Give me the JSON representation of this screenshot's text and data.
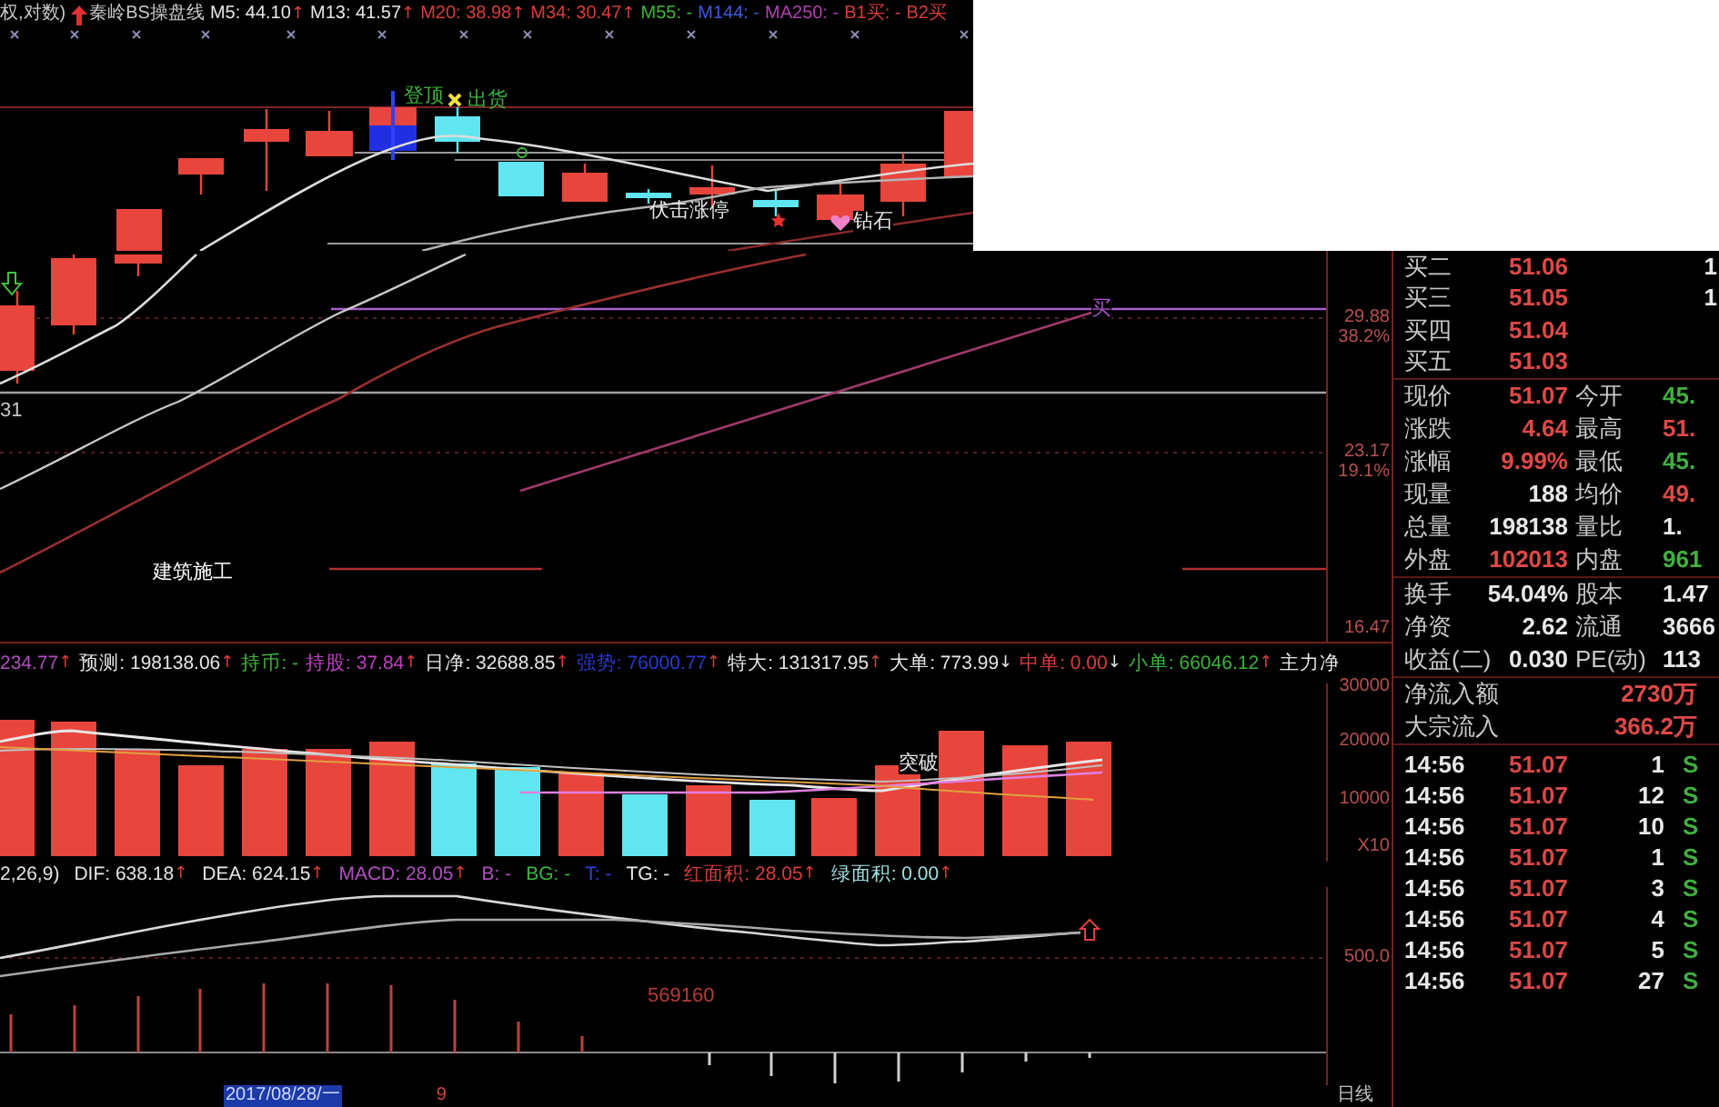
{
  "price_chart": {
    "legend": [
      {
        "kind": "text",
        "text": "权,对数)",
        "color": "#c8c8c8"
      },
      {
        "kind": "title",
        "text": "秦岭BS操盘线",
        "color": "#c8c8c8"
      },
      {
        "kind": "text",
        "text": "M5: 44.10",
        "color": "#e6e6e6",
        "arrow": {
          "text": "↑",
          "color": "#e03c3c"
        }
      },
      {
        "kind": "text",
        "text": "M13: 41.57",
        "color": "#e6e6e6",
        "arrow": {
          "text": "↑",
          "color": "#e03c3c"
        }
      },
      {
        "kind": "text",
        "text": "M20: 38.98",
        "color": "#d83c3c",
        "arrow": {
          "text": "↑",
          "color": "#e03c3c"
        }
      },
      {
        "kind": "text",
        "text": "M34: 30.47",
        "color": "#d83c3c",
        "arrow": {
          "text": "↑",
          "color": "#e03c3c"
        }
      },
      {
        "kind": "text",
        "text": "M55: -",
        "color": "#3cb43c"
      },
      {
        "kind": "text",
        "text": "M144: -",
        "color": "#3c5ad8"
      },
      {
        "kind": "text",
        "text": "MA250: -",
        "color": "#b040b0"
      },
      {
        "kind": "text",
        "text": "B1买: -",
        "color": "#d83c3c"
      },
      {
        "kind": "text",
        "text": "B2买",
        "color": "#d83c3c"
      }
    ],
    "annotations": [
      {
        "text": "登顶",
        "color": "#3cb43c"
      },
      {
        "text": "出货",
        "color": "#3cb43c"
      },
      {
        "text": "伏击涨停",
        "color": "#e6e6e6"
      },
      {
        "text": "钻石",
        "color": "#e6e6e6"
      },
      {
        "text": "31",
        "color": "#c8c8c8"
      },
      {
        "text": "建筑施工",
        "color": "#ffffff"
      },
      {
        "text": "买",
        "color": "#b050d0"
      }
    ],
    "axis_labels": [
      "29.88",
      "38.2%",
      "23.17",
      "19.1%",
      "16.47"
    ]
  },
  "volume_chart": {
    "legend": [
      {
        "kind": "text",
        "text": "234.77",
        "color": "#b050c0",
        "arrow": {
          "text": "↑",
          "color": "#e03c3c"
        }
      },
      {
        "kind": "text",
        "text": "预测: 198138.06",
        "color": "#e6e6e6",
        "arrow": {
          "text": "↑",
          "color": "#e03c3c"
        }
      },
      {
        "kind": "text",
        "text": "持币: -",
        "color": "#3cb43c"
      },
      {
        "kind": "text",
        "text": "持股: 37.84",
        "color": "#c040c0",
        "arrow": {
          "text": "↑",
          "color": "#e03c3c"
        }
      },
      {
        "kind": "text",
        "text": "日净: 32688.85",
        "color": "#e6e6e6",
        "arrow": {
          "text": "↑",
          "color": "#e03c3c"
        }
      },
      {
        "kind": "text",
        "text": "强势: 76000.77",
        "color": "#2a3ad0",
        "arrow": {
          "text": "↑",
          "color": "#e03c3c"
        }
      },
      {
        "kind": "text",
        "text": "特大: 131317.95",
        "color": "#e6e6e6",
        "arrow": {
          "text": "↑",
          "color": "#e03c3c"
        }
      },
      {
        "kind": "text",
        "text": "大单: 773.99",
        "color": "#e6e6e6",
        "arrow": {
          "text": "↓",
          "color": "#e6e6e6"
        }
      },
      {
        "kind": "text",
        "text": "中单: 0.00",
        "color": "#d83c3c",
        "arrow": {
          "text": "↓",
          "color": "#e6e6e6"
        }
      },
      {
        "kind": "text",
        "text": "小单: 66046.12",
        "color": "#3cb43c",
        "arrow": {
          "text": "↑",
          "color": "#e03c3c"
        }
      },
      {
        "kind": "text",
        "text": "主力净",
        "color": "#e6e6e6"
      }
    ],
    "annotation": "突破",
    "axis_labels": [
      "30000",
      "20000",
      "10000",
      "X10"
    ]
  },
  "macd_chart": {
    "legend": [
      {
        "kind": "text",
        "text": "2,26,9)",
        "color": "#e6e6e6"
      },
      {
        "kind": "text",
        "text": "DIF: 638.18",
        "color": "#e6e6e6",
        "arrow": {
          "text": "↑",
          "color": "#e03c3c"
        }
      },
      {
        "kind": "text",
        "text": "DEA: 624.15",
        "color": "#e6e6e6",
        "arrow": {
          "text": "↑",
          "color": "#e03c3c"
        }
      },
      {
        "kind": "text",
        "text": "MACD: 28.05",
        "color": "#b050c0",
        "arrow": {
          "text": "↑",
          "color": "#e03c3c"
        }
      },
      {
        "kind": "text",
        "text": "B: -",
        "color": "#b050c0"
      },
      {
        "kind": "text",
        "text": "BG: -",
        "color": "#3cb43c"
      },
      {
        "kind": "text",
        "text": "T: -",
        "color": "#3040e0"
      },
      {
        "kind": "text",
        "text": "TG: -",
        "color": "#e6e6e6"
      },
      {
        "kind": "text",
        "text": "红面积: 28.05",
        "color": "#d83c3c",
        "arrow": {
          "text": "↑",
          "color": "#e03c3c"
        }
      },
      {
        "kind": "text",
        "text": "绿面积: 0.00",
        "color": "#a0e0e0",
        "arrow": {
          "text": "↑",
          "color": "#e03c3c"
        }
      }
    ],
    "value_label": "569160",
    "axis_labels": [
      "500.0"
    ]
  },
  "date_bar": {
    "date": "2017/08/28/一",
    "marker": "9",
    "period": "日线"
  },
  "quote_panel": {
    "bids": [
      {
        "label": "买二",
        "price": "51.06",
        "volume": "1"
      },
      {
        "label": "买三",
        "price": "51.05",
        "volume": "1"
      },
      {
        "label": "买四",
        "price": "51.04"
      },
      {
        "label": "买五",
        "price": "51.03"
      }
    ],
    "quote": [
      {
        "label": "现价",
        "value": "51.07",
        "color": "#e04848"
      },
      {
        "label": "今开",
        "value": "45.",
        "color": "#40b040"
      },
      {
        "label": "涨跌",
        "value": "4.64",
        "color": "#e04848"
      },
      {
        "label": "最高",
        "value": "51.",
        "color": "#e04848"
      },
      {
        "label": "涨幅",
        "value": "9.99%",
        "color": "#e04848"
      },
      {
        "label": "最低",
        "value": "45.",
        "color": "#40b040"
      },
      {
        "label": "现量",
        "value": "188",
        "color": "#e8e8e8"
      },
      {
        "label": "均价",
        "value": "49.",
        "color": "#e04848"
      },
      {
        "label": "总量",
        "value": "198138",
        "color": "#e8e8e8"
      },
      {
        "label": "量比",
        "value": "1.",
        "color": "#e8e8e8"
      },
      {
        "label": "外盘",
        "value": "102013",
        "color": "#e04848"
      },
      {
        "label": "内盘",
        "value": "961",
        "color": "#40b040"
      }
    ],
    "fundamentals": [
      {
        "label": "换手",
        "value": "54.04%"
      },
      {
        "label": "股本",
        "value": "1.47"
      },
      {
        "label": "净资",
        "value": "2.62"
      },
      {
        "label": "流通",
        "value": "3666"
      },
      {
        "label": "收益(二)",
        "value": "0.030"
      },
      {
        "label": "PE(动)",
        "value": "113"
      }
    ],
    "flows": [
      {
        "label": "净流入额",
        "value": "2730万"
      },
      {
        "label": "大宗流入",
        "value": "366.2万"
      }
    ],
    "ticks": [
      {
        "time": "14:56",
        "price": "51.07",
        "volume": "1",
        "side": "S"
      },
      {
        "time": "14:56",
        "price": "51.07",
        "volume": "12",
        "side": "S"
      },
      {
        "time": "14:56",
        "price": "51.07",
        "volume": "10",
        "side": "S"
      },
      {
        "time": "14:56",
        "price": "51.07",
        "volume": "1",
        "side": "S"
      },
      {
        "time": "14:56",
        "price": "51.07",
        "volume": "3",
        "side": "S"
      },
      {
        "time": "14:56",
        "price": "51.07",
        "volume": "4",
        "side": "S"
      },
      {
        "time": "14:56",
        "price": "51.07",
        "volume": "5",
        "side": "S"
      },
      {
        "time": "14:56",
        "price": "51.07",
        "volume": "27",
        "side": "S"
      }
    ]
  }
}
